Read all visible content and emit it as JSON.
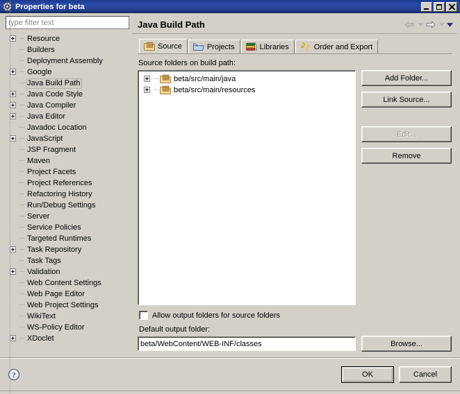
{
  "window": {
    "title": "Properties for beta",
    "icon": "properties-gear-icon",
    "controls": {
      "minimize": "minimize-button",
      "maximize": "maximize-button",
      "close": "close-button"
    }
  },
  "sidebar": {
    "filter": {
      "placeholder": "type filter text",
      "value": ""
    },
    "items": [
      {
        "label": "Resource",
        "expandable": true,
        "selected": false
      },
      {
        "label": "Builders",
        "expandable": false,
        "selected": false
      },
      {
        "label": "Deployment Assembly",
        "expandable": false,
        "selected": false
      },
      {
        "label": "Google",
        "expandable": true,
        "selected": false
      },
      {
        "label": "Java Build Path",
        "expandable": false,
        "selected": true
      },
      {
        "label": "Java Code Style",
        "expandable": true,
        "selected": false
      },
      {
        "label": "Java Compiler",
        "expandable": true,
        "selected": false
      },
      {
        "label": "Java Editor",
        "expandable": true,
        "selected": false
      },
      {
        "label": "Javadoc Location",
        "expandable": false,
        "selected": false
      },
      {
        "label": "JavaScript",
        "expandable": true,
        "selected": false
      },
      {
        "label": "JSP Fragment",
        "expandable": false,
        "selected": false
      },
      {
        "label": "Maven",
        "expandable": false,
        "selected": false
      },
      {
        "label": "Project Facets",
        "expandable": false,
        "selected": false
      },
      {
        "label": "Project References",
        "expandable": false,
        "selected": false
      },
      {
        "label": "Refactoring History",
        "expandable": false,
        "selected": false
      },
      {
        "label": "Run/Debug Settings",
        "expandable": false,
        "selected": false
      },
      {
        "label": "Server",
        "expandable": false,
        "selected": false
      },
      {
        "label": "Service Policies",
        "expandable": false,
        "selected": false
      },
      {
        "label": "Targeted Runtimes",
        "expandable": false,
        "selected": false
      },
      {
        "label": "Task Repository",
        "expandable": true,
        "selected": false
      },
      {
        "label": "Task Tags",
        "expandable": false,
        "selected": false
      },
      {
        "label": "Validation",
        "expandable": true,
        "selected": false
      },
      {
        "label": "Web Content Settings",
        "expandable": false,
        "selected": false
      },
      {
        "label": "Web Page Editor",
        "expandable": false,
        "selected": false
      },
      {
        "label": "Web Project Settings",
        "expandable": false,
        "selected": false
      },
      {
        "label": "WikiText",
        "expandable": false,
        "selected": false
      },
      {
        "label": "WS-Policy Editor",
        "expandable": false,
        "selected": false
      },
      {
        "label": "XDoclet",
        "expandable": true,
        "selected": false
      }
    ]
  },
  "page": {
    "title": "Java Build Path",
    "nav": {
      "back": "back-arrow",
      "back_menu": "back-dropdown",
      "forward": "forward-arrow",
      "forward_menu": "forward-dropdown",
      "menu": "view-menu-chevron"
    },
    "tabs": [
      {
        "label": "Source",
        "icon": "source-package-icon",
        "active": true
      },
      {
        "label": "Projects",
        "icon": "open-folder-icon",
        "active": false
      },
      {
        "label": "Libraries",
        "icon": "books-icon",
        "active": false
      },
      {
        "label": "Order and Export",
        "icon": "order-arrows-icon",
        "active": false
      }
    ],
    "source_label": "Source folders on build path:",
    "source_folders": [
      {
        "label": "beta/src/main/java",
        "icon": "package-folder-icon",
        "expandable": true
      },
      {
        "label": "beta/src/main/resources",
        "icon": "package-folder-icon",
        "expandable": true
      }
    ],
    "buttons": [
      {
        "label": "Add Folder...",
        "enabled": true,
        "gap_above": false
      },
      {
        "label": "Link Source...",
        "enabled": true,
        "gap_above": false
      },
      {
        "label": "Edit...",
        "enabled": false,
        "gap_above": true
      },
      {
        "label": "Remove",
        "enabled": true,
        "gap_above": false
      }
    ],
    "allow_output_folders": {
      "label": "Allow output folders for source folders",
      "checked": false
    },
    "default_output": {
      "label": "Default output folder:",
      "value": "beta/WebContent/WEB-INF/classes",
      "browse_label": "Browse..."
    }
  },
  "footer": {
    "help_icon": "help-question-icon",
    "ok_label": "OK",
    "cancel_label": "Cancel"
  },
  "colors": {
    "title_bar": "#1b3a91",
    "dialog_bg": "#d4d0c8",
    "selection": "#d0cdc5",
    "folder_icon": "#e8b96a",
    "accent_text": "#000000"
  }
}
